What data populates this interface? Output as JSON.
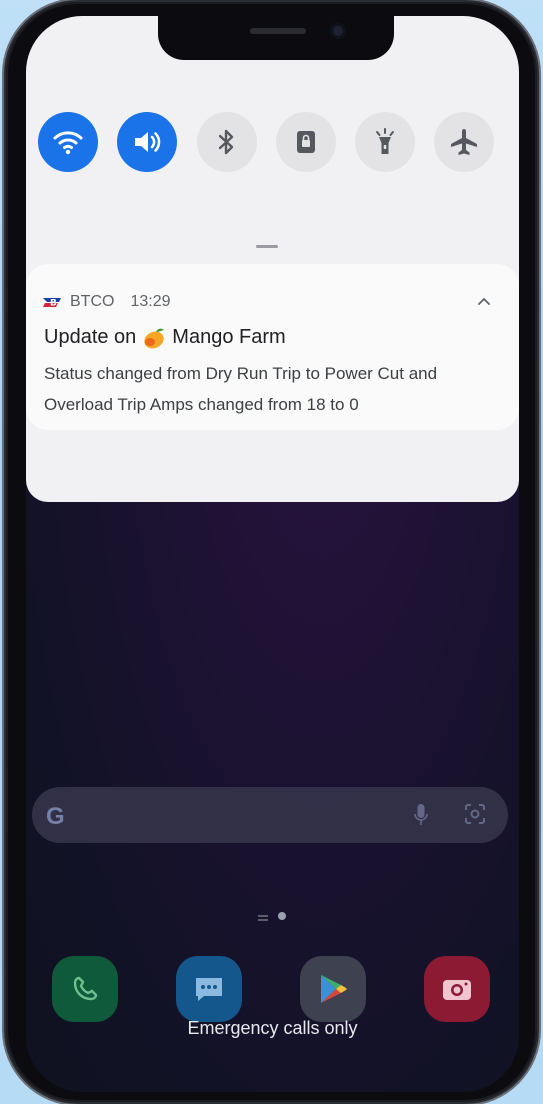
{
  "quick_settings": {
    "tiles": [
      {
        "name": "wifi",
        "icon": "wifi-icon",
        "active": true
      },
      {
        "name": "sound",
        "icon": "volume-icon",
        "active": true
      },
      {
        "name": "bluetooth",
        "icon": "bluetooth-icon",
        "active": false
      },
      {
        "name": "screen-lock",
        "icon": "lock-screen-icon",
        "active": false
      },
      {
        "name": "flashlight",
        "icon": "flashlight-icon",
        "active": false
      },
      {
        "name": "airplane",
        "icon": "airplane-icon",
        "active": false
      }
    ]
  },
  "notification": {
    "app_name": "BTCO",
    "time": "13:29",
    "title_prefix": "Update on",
    "title_suffix": "Mango Farm",
    "body": "Status changed from Dry Run Trip to Power Cut and Overload Trip Amps changed from 18 to 0"
  },
  "search_bar": {
    "logo_letter": "G",
    "icons": [
      "mic-icon",
      "lens-icon"
    ]
  },
  "dock": {
    "apps": [
      "phone-app-icon",
      "messages-app-icon",
      "play-store-icon",
      "camera-app-icon"
    ]
  },
  "status": {
    "emergency_text": "Emergency calls only"
  },
  "colors": {
    "accent": "#1a73e8",
    "panel": "#f1f1f3"
  }
}
